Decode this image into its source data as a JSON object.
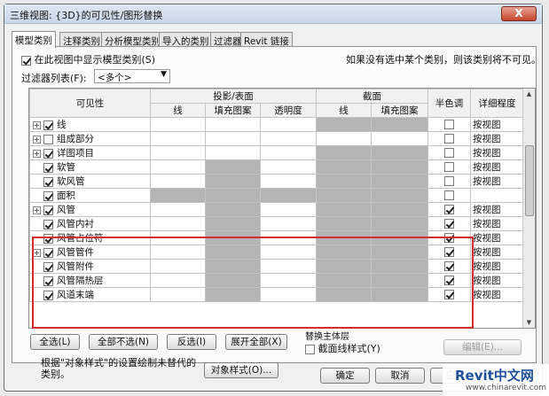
{
  "window": {
    "title": "三维视图: {3D}的可见性/图形替换",
    "close_label": "X"
  },
  "tabs": [
    "模型类别",
    "注释类别",
    "分析模型类别",
    "导入的类别",
    "过滤器",
    "Revit 链接"
  ],
  "panel": {
    "show_categories_label": "在此视图中显示模型类别(S)",
    "hint": "如果没有选中某个类别，则该类别将不可见。",
    "filter_list_label": "过滤器列表(F):",
    "filter_value": "<多个>"
  },
  "grid": {
    "headers": {
      "visibility": "可见性",
      "projection": "投影/表面",
      "section": "截面",
      "halftone": "半色调",
      "detail": "详细程度",
      "line": "线",
      "fill_pattern": "填充图案",
      "transparency": "透明度",
      "section_line": "线",
      "section_fill": "填充图案"
    },
    "rows": [
      {
        "name": "线",
        "expander": "+",
        "checked": true,
        "halftone": false,
        "detail": "按视图",
        "gray": [
          false,
          false,
          false,
          true,
          true
        ]
      },
      {
        "name": "组成部分",
        "expander": "+",
        "checked": false,
        "halftone": false,
        "detail": "按视图",
        "gray": [
          false,
          false,
          false,
          false,
          false
        ]
      },
      {
        "name": "详图项目",
        "expander": "+",
        "checked": true,
        "halftone": false,
        "detail": "按视图",
        "gray": [
          false,
          false,
          false,
          true,
          true
        ]
      },
      {
        "name": "软管",
        "expander": "",
        "checked": true,
        "halftone": false,
        "detail": "按视图",
        "gray": [
          false,
          true,
          false,
          true,
          true
        ]
      },
      {
        "name": "软风管",
        "expander": "",
        "checked": true,
        "halftone": false,
        "detail": "按视图",
        "gray": [
          false,
          true,
          false,
          true,
          true
        ]
      },
      {
        "name": "面积",
        "expander": "",
        "checked": true,
        "halftone": false,
        "detail": "",
        "gray": [
          true,
          true,
          true,
          true,
          true
        ]
      },
      {
        "name": "风管",
        "expander": "+",
        "checked": true,
        "halftone": true,
        "detail": "按视图",
        "gray": [
          false,
          true,
          false,
          true,
          true
        ]
      },
      {
        "name": "风管内衬",
        "expander": "",
        "checked": true,
        "halftone": true,
        "detail": "按视图",
        "gray": [
          false,
          true,
          false,
          true,
          true
        ]
      },
      {
        "name": "风管占位符",
        "expander": "",
        "checked": true,
        "halftone": true,
        "detail": "按视图",
        "gray": [
          false,
          true,
          false,
          true,
          true
        ]
      },
      {
        "name": "风管管件",
        "expander": "+",
        "checked": true,
        "halftone": true,
        "detail": "按视图",
        "gray": [
          false,
          true,
          false,
          true,
          true
        ]
      },
      {
        "name": "风管附件",
        "expander": "",
        "checked": true,
        "halftone": true,
        "detail": "按视图",
        "gray": [
          false,
          true,
          false,
          true,
          true
        ]
      },
      {
        "name": "风管隔热层",
        "expander": "",
        "checked": true,
        "halftone": true,
        "detail": "按视图",
        "gray": [
          false,
          true,
          false,
          true,
          true
        ]
      },
      {
        "name": "风道末端",
        "expander": "",
        "checked": true,
        "halftone": true,
        "detail": "按视图",
        "gray": [
          false,
          true,
          false,
          true,
          true
        ]
      }
    ]
  },
  "buttons": {
    "select_all": "全选(L)",
    "select_none": "全部不选(N)",
    "invert": "反选(I)",
    "expand_all": "展开全部(X)",
    "edit": "编辑(E)...",
    "object_styles": "对象样式(O)...",
    "ok": "确定",
    "cancel": "取消",
    "apply": "应用"
  },
  "host": {
    "label": "替换主体层",
    "cut_line_label": "截面线样式(Y)"
  },
  "note": "根据\"对象样式\"的设置绘制未替代的类别。",
  "watermark": {
    "brand": "Revit中文网",
    "url": "www.chinarevit.com"
  }
}
